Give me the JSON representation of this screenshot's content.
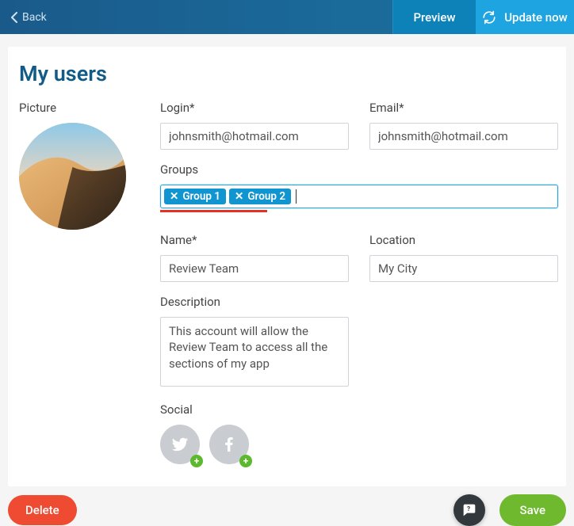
{
  "header": {
    "back_label": "Back",
    "preview_label": "Preview",
    "update_label": "Update now"
  },
  "page": {
    "title": "My users"
  },
  "form": {
    "picture_label": "Picture",
    "login": {
      "label": "Login*",
      "value": "johnsmith@hotmail.com"
    },
    "email": {
      "label": "Email*",
      "value": "johnsmith@hotmail.com"
    },
    "groups": {
      "label": "Groups",
      "tags": [
        "Group 1",
        "Group 2"
      ]
    },
    "name": {
      "label": "Name*",
      "value": "Review Team"
    },
    "location": {
      "label": "Location",
      "value": "My City"
    },
    "description": {
      "label": "Description",
      "value": "This account will allow the Review Team to access all the sections of my app"
    },
    "social": {
      "label": "Social",
      "icons": [
        "twitter-icon",
        "facebook-icon"
      ]
    }
  },
  "footer": {
    "delete_label": "Delete",
    "save_label": "Save"
  }
}
